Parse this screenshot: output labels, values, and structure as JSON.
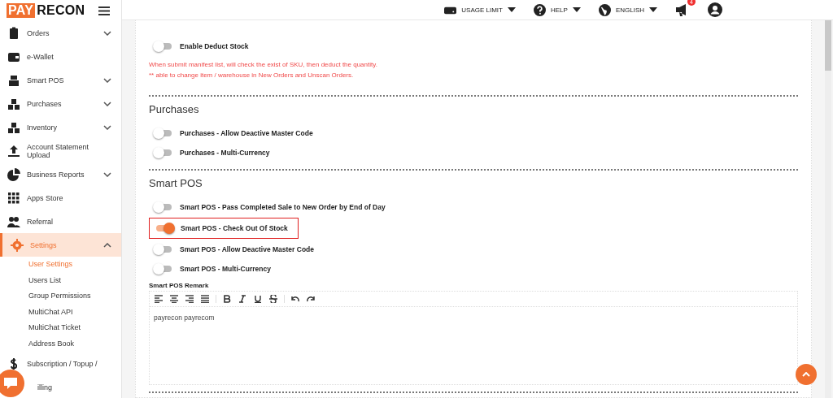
{
  "logo": {
    "part_1": "PAY",
    "part_2": "RECON"
  },
  "topbar": {
    "items": [
      {
        "label": "USAGE LIMIT"
      },
      {
        "label": "HELP"
      },
      {
        "label": "ENGLISH"
      }
    ],
    "notifications": {
      "count": "4"
    }
  },
  "sidebar": {
    "items": [
      {
        "label": "Orders",
        "selected": false,
        "expanded": false
      },
      {
        "label": "e-Wallet",
        "selected": false
      },
      {
        "label": "Smart POS",
        "selected": false,
        "expanded": false
      },
      {
        "label": "Purchases",
        "selected": false,
        "expanded": false
      },
      {
        "label": "Inventory",
        "selected": false,
        "expanded": false
      },
      {
        "label": "Account Statement Upload",
        "selected": false
      },
      {
        "label": "Business Reports",
        "selected": false,
        "expanded": false
      },
      {
        "label": "Apps Store",
        "selected": false
      },
      {
        "label": "Referral",
        "selected": false
      },
      {
        "label": "Settings",
        "selected": true,
        "expanded": true,
        "children": [
          {
            "label": "User Settings",
            "selected": true
          },
          {
            "label": "Users List",
            "selected": false
          },
          {
            "label": "Group Permissions",
            "selected": false
          },
          {
            "label": "MultiChat API",
            "selected": false
          },
          {
            "label": "MultiChat Ticket",
            "selected": false
          },
          {
            "label": "Address Book",
            "selected": false
          }
        ]
      },
      {
        "label": "Subscription / Topup /",
        "selected": false
      },
      {
        "label": "illing",
        "selected": false
      }
    ]
  },
  "sections": [
    {
      "rows": [
        {
          "kind": "toggle",
          "label": "Enable Deduct Stock",
          "on": false,
          "highlighted": false
        },
        {
          "kind": "note",
          "label": "When submit manifest list, will check the exist of SKU, then deduct the quantity."
        },
        {
          "kind": "note",
          "label": "** able to change item / warehouse in New Orders and Unscan Orders."
        }
      ]
    },
    {
      "title": "Purchases",
      "rows": [
        {
          "kind": "toggle",
          "label": "Purchases - Allow Deactive Master Code",
          "on": false,
          "highlighted": false
        },
        {
          "kind": "toggle",
          "label": "Purchases - Multi-Currency",
          "on": false,
          "highlighted": false
        }
      ]
    },
    {
      "title": "Smart POS",
      "rows": [
        {
          "kind": "toggle",
          "label": "Smart POS - Pass Completed Sale to New Order by End of Day",
          "on": false,
          "highlighted": false
        },
        {
          "kind": "toggle",
          "label": "Smart POS - Check Out Of Stock",
          "on": true,
          "highlighted": true
        },
        {
          "kind": "toggle",
          "label": "Smart POS - Allow Deactive Master Code",
          "on": false,
          "highlighted": false
        },
        {
          "kind": "toggle",
          "label": "Smart POS - Multi-Currency",
          "on": false,
          "highlighted": false
        },
        {
          "kind": "editor",
          "label": "Smart POS Remark",
          "value": "payrecon payrecom"
        }
      ]
    }
  ]
}
